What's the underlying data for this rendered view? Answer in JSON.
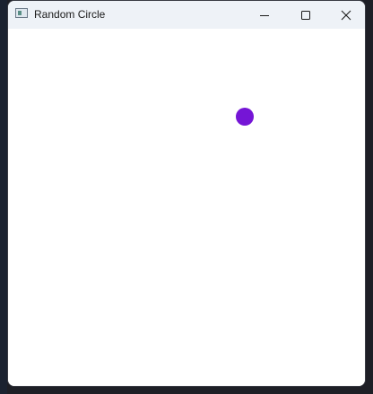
{
  "window": {
    "title": "Random Circle",
    "icon": "app-window-icon"
  },
  "controls": {
    "minimize_icon": "minimize-icon",
    "maximize_icon": "maximize-icon",
    "close_icon": "close-icon"
  },
  "canvas": {
    "circle_color": "#7515d6"
  }
}
